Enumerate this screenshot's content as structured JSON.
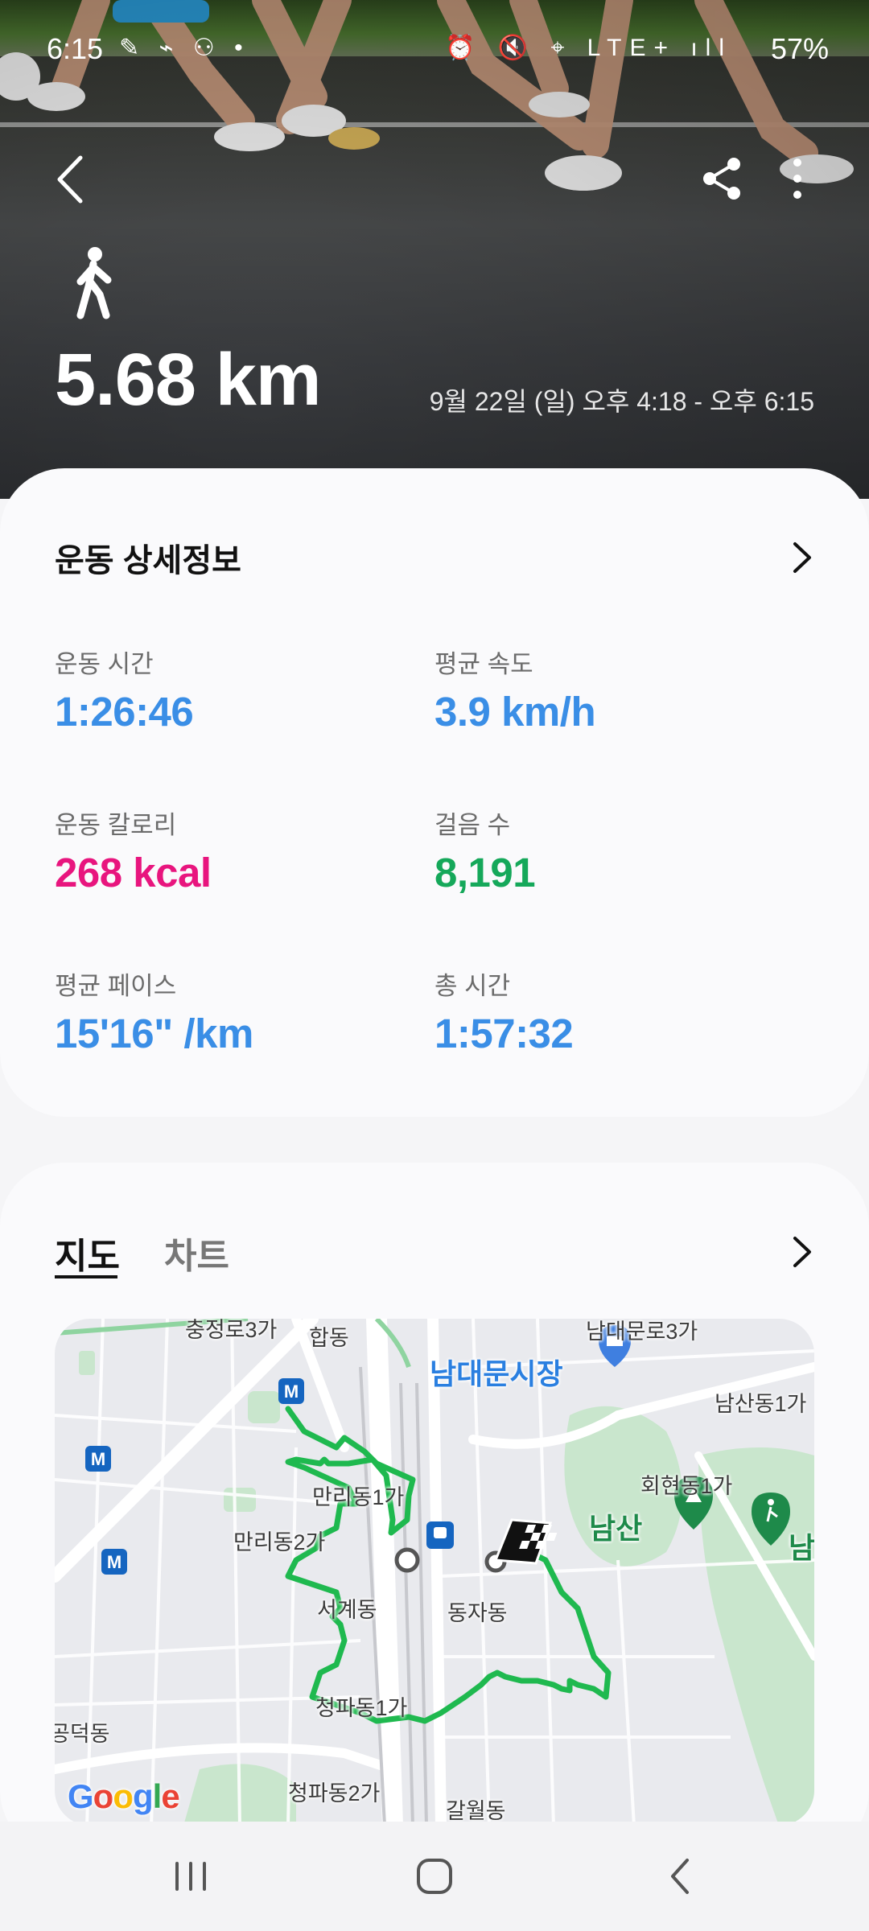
{
  "status_bar": {
    "time": "6:15",
    "left_icons": "✎ ⌁ ⚇ •",
    "right_icons": "⏰ 🔇 ⌖ LTE+ ıll",
    "battery": "57%"
  },
  "hero": {
    "activity_icon": "walking-person-icon",
    "distance": "5.68 km",
    "date_range": "9월 22일 (일) 오후 4:18 - 오후 6:15"
  },
  "details": {
    "title": "운동 상세정보",
    "stats": [
      {
        "label": "운동 시간",
        "value": "1:26:46",
        "color": "#3a8ee6"
      },
      {
        "label": "평균 속도",
        "value": "3.9 km/h",
        "color": "#3a8ee6"
      },
      {
        "label": "운동 칼로리",
        "value": "268 kcal",
        "color": "#e8157e"
      },
      {
        "label": "걸음 수",
        "value": "8,191",
        "color": "#15a85a"
      },
      {
        "label": "평균 페이스",
        "value": "15'16\" /km",
        "color": "#3a8ee6"
      },
      {
        "label": "총 시간",
        "value": "1:57:32",
        "color": "#3a8ee6"
      }
    ]
  },
  "map_section": {
    "tabs": [
      {
        "label": "지도",
        "active": true
      },
      {
        "label": "차트",
        "active": false
      }
    ],
    "map_labels": {
      "l1": "충정로3가",
      "l2": "합동",
      "l3": "남대문로3가",
      "l4": "남대문시장",
      "l5": "남산동1가",
      "l6": "회현동1가",
      "l7": "만리동1가",
      "l8": "만리동2가",
      "l9": "남산",
      "l10": "남",
      "l11": "서계동",
      "l12": "동자동",
      "l13": "청파동1가",
      "l14": "공덕동",
      "l15": "청파동2가",
      "l16": "갈월동"
    },
    "attribution": [
      "G",
      "o",
      "o",
      "g",
      "l",
      "e"
    ],
    "route_color": "#1fb94f"
  },
  "nav_bar": {
    "recent": "recent-apps-icon",
    "home": "home-icon",
    "back": "back-icon"
  }
}
